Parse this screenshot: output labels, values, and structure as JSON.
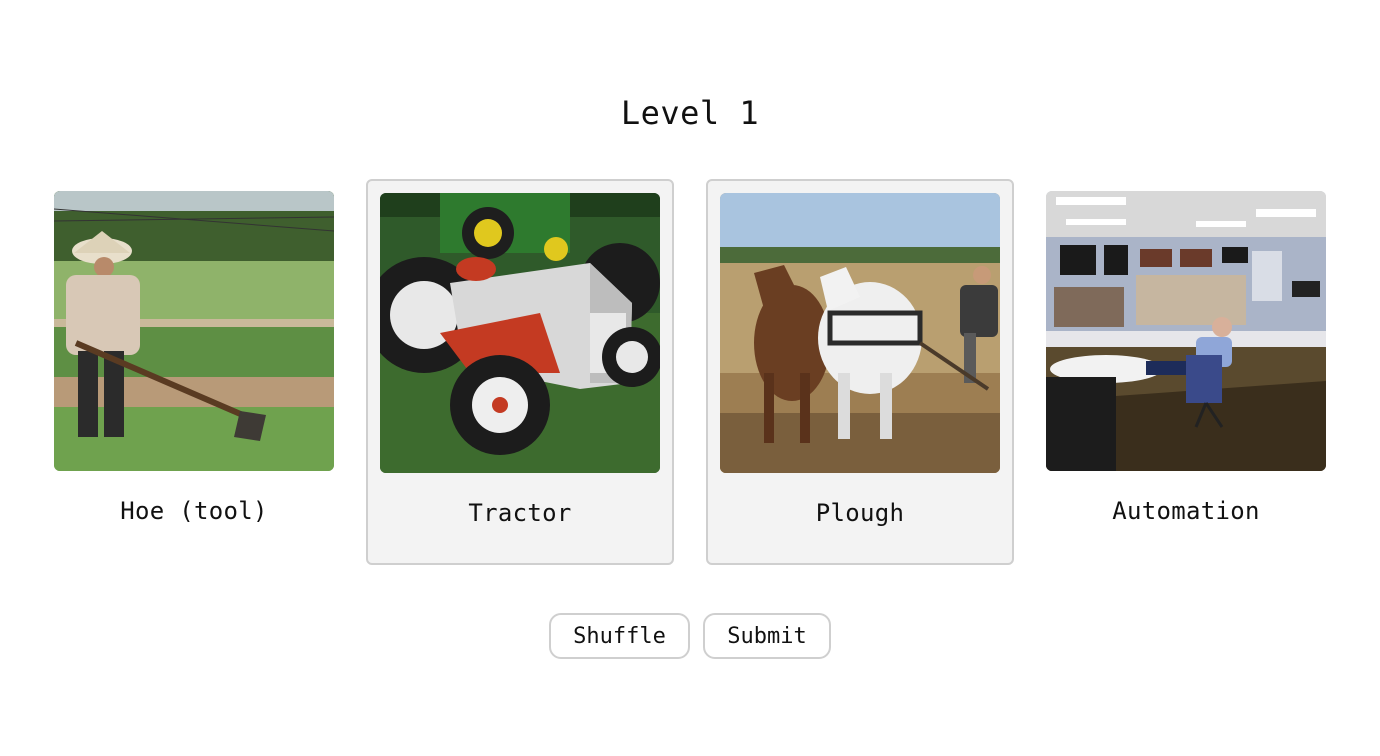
{
  "game": {
    "title": "Level 1"
  },
  "cards": [
    {
      "label": "Hoe (tool)",
      "selected": false
    },
    {
      "label": "Tractor",
      "selected": true
    },
    {
      "label": "Plough",
      "selected": true
    },
    {
      "label": "Automation",
      "selected": false
    }
  ],
  "buttons": {
    "shuffle": "Shuffle",
    "submit": "Submit"
  }
}
